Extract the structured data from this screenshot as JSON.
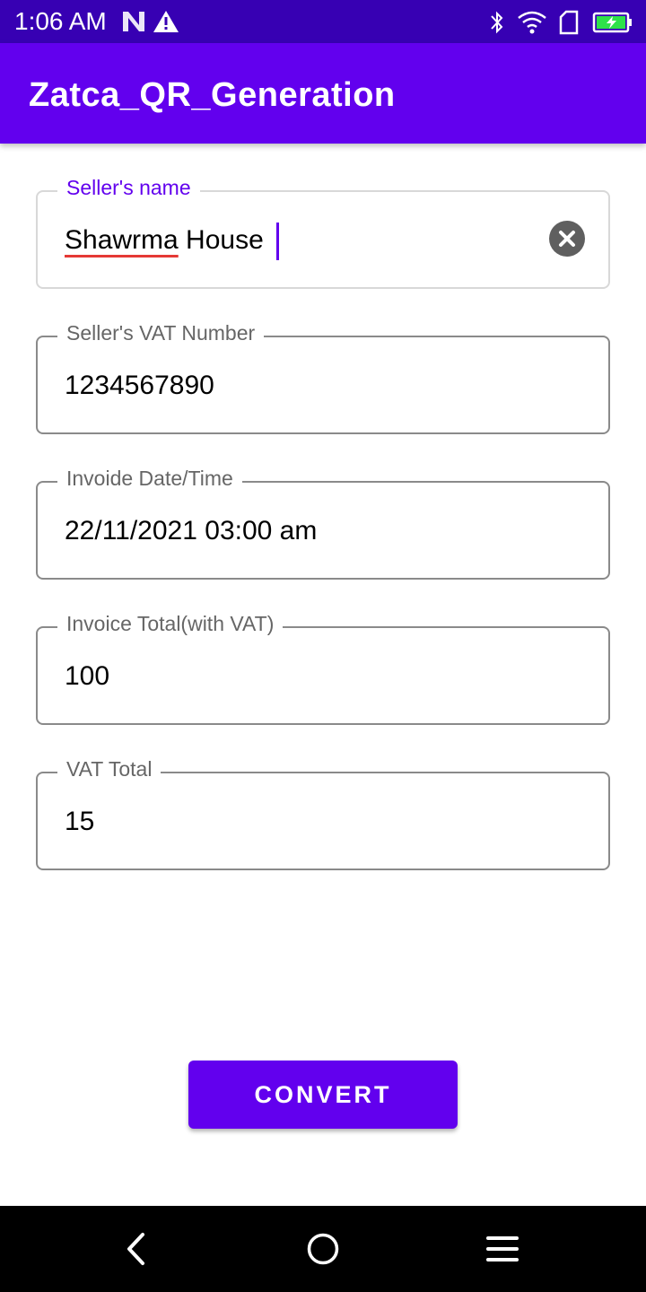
{
  "status_bar": {
    "time": "1:06 AM",
    "left_icons": [
      "notification-n-icon",
      "warning-icon"
    ],
    "right_icons": [
      "bluetooth-icon",
      "wifi-icon",
      "sim-card-icon",
      "battery-charging-icon"
    ],
    "battery_color": "#2ee24a"
  },
  "app_bar": {
    "title": "Zatca_QR_Generation",
    "color": "#6200ee"
  },
  "form": {
    "seller_name": {
      "label": "Seller's name",
      "value_word_1": "Shawrma",
      "value_rest": " House",
      "clear_icon": "clear-icon"
    },
    "vat_number": {
      "label": "Seller's VAT Number",
      "value": "1234567890"
    },
    "invoice_date": {
      "label": "Invoide Date/Time",
      "value": "22/11/2021 03:00 am"
    },
    "invoice_total": {
      "label": "Invoice Total(with VAT)",
      "value": "100"
    },
    "vat_total": {
      "label": "VAT Total",
      "value": "15"
    }
  },
  "convert_button": {
    "label": "CONVERT"
  },
  "nav_bar": {
    "icons": [
      "back-icon",
      "home-icon",
      "menu-icon"
    ]
  }
}
